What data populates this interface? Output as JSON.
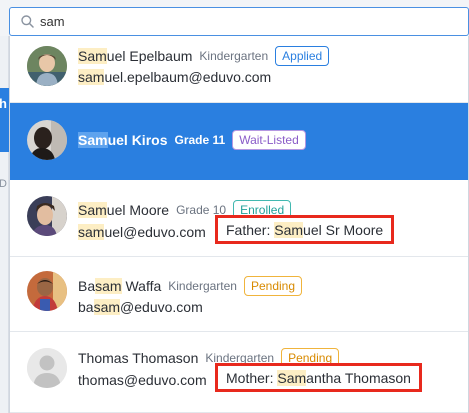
{
  "search": {
    "value": "sam",
    "placeholder": ""
  },
  "background": {
    "header_fragment": "h",
    "side_fragment": "D"
  },
  "results": [
    {
      "name_hl": "Sam",
      "name_rest": "uel Epelbaum",
      "grade": "Kindergarten",
      "status": "Applied",
      "email_hl": "sam",
      "email_rest": "uel.epelbaum@eduvo.com"
    },
    {
      "name_hl": "Sam",
      "name_rest": "uel Kiros",
      "grade": "Grade 11",
      "status": "Wait-Listed"
    },
    {
      "name_hl": "Sam",
      "name_rest": "uel Moore",
      "grade": "Grade 10",
      "status": "Enrolled",
      "email_hl": "sam",
      "email_rest": "uel@eduvo.com",
      "relation_prefix": "Father: ",
      "relation_hl": "Sam",
      "relation_rest": "uel Sr Moore"
    },
    {
      "name_pre": "Ba",
      "name_hl": "sam",
      "name_rest": " Waffa",
      "grade": "Kindergarten",
      "status": "Pending",
      "email_pre": "ba",
      "email_hl": "sam",
      "email_rest": "@eduvo.com"
    },
    {
      "name": "Thomas Thomason",
      "grade": "Kindergarten",
      "status": "Pending",
      "email": "thomas@eduvo.com",
      "relation_prefix": "Mother: ",
      "relation_hl": "Sam",
      "relation_rest": "antha Thomason"
    }
  ],
  "colors": {
    "accent": "#2a7fe0",
    "highlight": "#fdeec4",
    "callout": "#e8291d"
  }
}
